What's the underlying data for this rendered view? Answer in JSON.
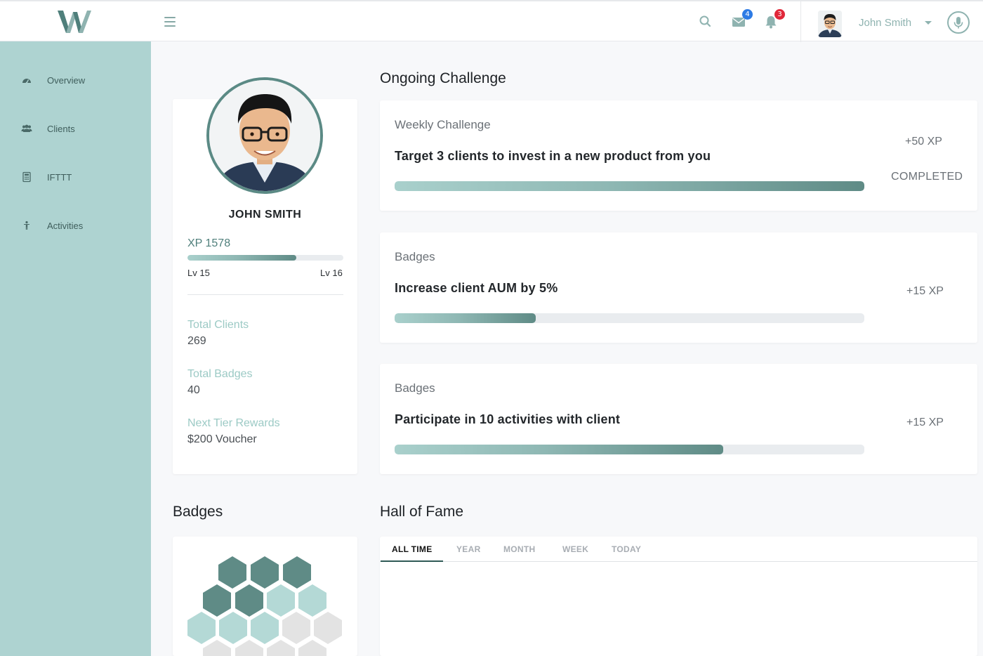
{
  "header": {
    "mail_count": "4",
    "notification_count": "3",
    "user_name": "John Smith",
    "colors": {
      "mail_badge": "#2d7be5",
      "notification_badge": "#e0283a",
      "accent": "#5b8a85"
    }
  },
  "sidebar": {
    "items": [
      {
        "label": "Overview",
        "icon": "dashboard-icon"
      },
      {
        "label": "Clients",
        "icon": "users-icon"
      },
      {
        "label": "IFTTT",
        "icon": "calculator-icon"
      },
      {
        "label": "Activities",
        "icon": "person-icon"
      }
    ]
  },
  "profile": {
    "name": "JOHN SMITH",
    "xp_label": "XP 1578",
    "xp_progress": 0.7,
    "level_current": "Lv 15",
    "level_next": "Lv 16",
    "stats": [
      {
        "label": "Total Clients",
        "value": "269"
      },
      {
        "label": "Total Badges",
        "value": "40"
      },
      {
        "label": "Next Tier Rewards",
        "value": "$200 Voucher"
      }
    ]
  },
  "ongoing": {
    "title": "Ongoing Challenge",
    "challenges": [
      {
        "kind": "Weekly Challenge",
        "title": "Target 3 clients to invest in a new product from you",
        "xp": "+50 XP",
        "status": "COMPLETED",
        "progress": 1.0
      },
      {
        "kind": "Badges",
        "title": "Increase client AUM by 5%",
        "xp": "+15 XP",
        "status": "",
        "progress": 0.3
      },
      {
        "kind": "Badges",
        "title": "Participate in 10 activities with client",
        "xp": "+15 XP",
        "status": "",
        "progress": 0.7
      }
    ]
  },
  "badges": {
    "title": "Badges"
  },
  "hall_of_fame": {
    "title": "Hall of Fame",
    "tabs": [
      "ALL TIME",
      "YEAR",
      "MONTH",
      "WEEK",
      "TODAY"
    ],
    "active_tab": "ALL TIME"
  }
}
